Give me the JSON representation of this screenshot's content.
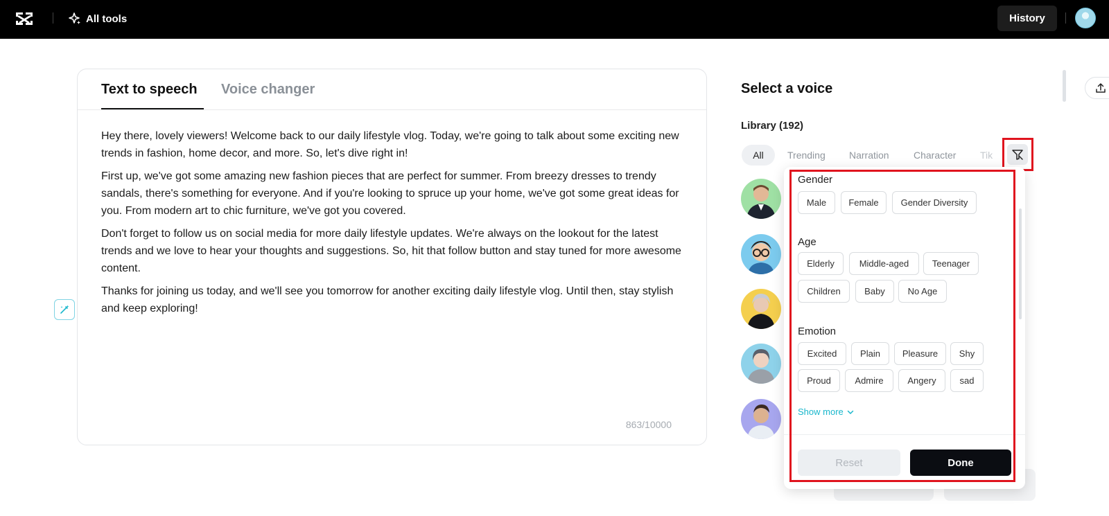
{
  "topbar": {
    "logo_icon": "capcut-logo-icon",
    "all_tools_label": "All tools",
    "history_label": "History"
  },
  "tabs": [
    {
      "label": "Text to speech",
      "active": true
    },
    {
      "label": "Voice changer",
      "active": false
    }
  ],
  "editor": {
    "paragraphs": [
      "Hey there, lovely viewers! Welcome back to our daily lifestyle vlog. Today, we're going to talk about some exciting new trends in fashion, home decor, and more. So, let's dive right in!",
      "First up, we've got some amazing new fashion pieces that are perfect for summer. From breezy dresses to trendy sandals, there's something for everyone. And if you're looking to spruce up your home, we've got some great ideas for you. From modern art to chic furniture, we've got you covered.",
      "Don't forget to follow us on social media for more daily lifestyle updates. We're always on the lookout for the latest trends and we love to hear your thoughts and suggestions. So, hit that follow button and stay tuned for more awesome content.",
      "Thanks for joining us today, and we'll see you tomorrow for another exciting daily lifestyle vlog. Until then, stay stylish and keep exploring!"
    ],
    "char_count": "863/10000"
  },
  "voice_panel": {
    "title": "Select a voice",
    "library_label": "Library (192)",
    "categories": [
      "All",
      "Trending",
      "Narration",
      "Character",
      "Tik"
    ],
    "active_category": "All"
  },
  "filter": {
    "gender": {
      "title": "Gender",
      "options": [
        "Male",
        "Female",
        "Gender Diversity"
      ]
    },
    "age": {
      "title": "Age",
      "options": [
        "Elderly",
        "Middle-aged",
        "Teenager",
        "Children",
        "Baby",
        "No Age"
      ]
    },
    "emotion": {
      "title": "Emotion",
      "options": [
        "Excited",
        "Plain",
        "Pleasure",
        "Shy",
        "Proud",
        "Admire",
        "Angery",
        "sad"
      ]
    },
    "show_more_label": "Show more",
    "reset_label": "Reset",
    "done_label": "Done"
  },
  "colors": {
    "accent": "#19b7cc",
    "highlight": "#e0141e",
    "topbar": "#000000"
  }
}
